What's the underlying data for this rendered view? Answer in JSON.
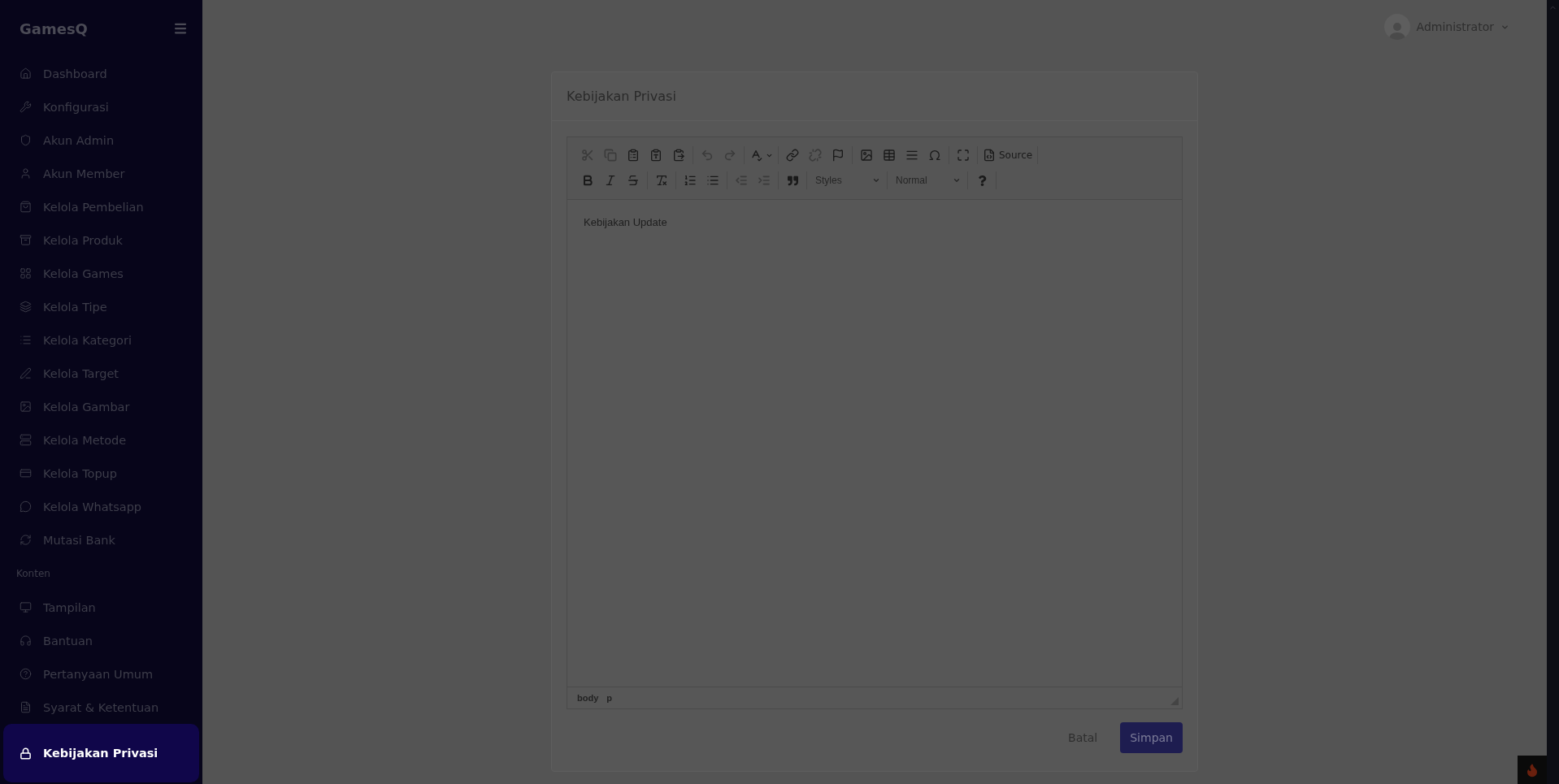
{
  "sidebar": {
    "brand": "GamesQ",
    "sections": [
      {
        "items": [
          {
            "kind": "home",
            "label": "Dashboard",
            "selected": false
          },
          {
            "kind": "wrench",
            "label": "Konfigurasi",
            "selected": false
          },
          {
            "kind": "shield",
            "label": "Akun Admin",
            "selected": false
          },
          {
            "kind": "user",
            "label": "Akun Member",
            "selected": false
          },
          {
            "kind": "bag",
            "label": "Kelola Pembelian",
            "selected": false
          },
          {
            "kind": "archive",
            "label": "Kelola Produk",
            "selected": false
          },
          {
            "kind": "grid",
            "label": "Kelola Games",
            "selected": false
          },
          {
            "kind": "layers",
            "label": "Kelola Tipe",
            "selected": false
          },
          {
            "kind": "list",
            "label": "Kelola Kategori",
            "selected": false
          },
          {
            "kind": "pen",
            "label": "Kelola Target",
            "selected": false
          },
          {
            "kind": "image",
            "label": "Kelola Gambar",
            "selected": false
          },
          {
            "kind": "server",
            "label": "Kelola Metode",
            "selected": false
          },
          {
            "kind": "card",
            "label": "Kelola Topup",
            "selected": false
          },
          {
            "kind": "chat",
            "label": "Kelola Whatsapp",
            "selected": false
          },
          {
            "kind": "refresh",
            "label": "Mutasi Bank",
            "selected": false
          }
        ]
      },
      {
        "heading": "Konten",
        "items": [
          {
            "kind": "monitor",
            "label": "Tampilan",
            "selected": false
          },
          {
            "kind": "headphones",
            "label": "Bantuan",
            "selected": false
          },
          {
            "kind": "help",
            "label": "Pertanyaan Umum",
            "selected": false
          },
          {
            "kind": "file",
            "label": "Syarat & Ketentuan",
            "selected": false
          },
          {
            "kind": "lock",
            "label": "Kebijakan Privasi",
            "selected": true
          }
        ]
      }
    ]
  },
  "user": {
    "name": "Administrator"
  },
  "card": {
    "title": "Kebijakan Privasi"
  },
  "editor": {
    "toolbar": [
      [
        [
          {
            "kind": "cut",
            "disabled": true
          },
          {
            "kind": "copy",
            "disabled": true
          },
          {
            "kind": "paste",
            "disabled": false
          },
          {
            "kind": "paste-text",
            "disabled": false
          },
          {
            "kind": "paste-word",
            "disabled": false
          }
        ],
        [
          {
            "kind": "undo",
            "disabled": true
          },
          {
            "kind": "redo",
            "disabled": true
          }
        ],
        [
          {
            "kind": "spellcheck",
            "disabled": false
          }
        ],
        [
          {
            "kind": "link",
            "disabled": false
          },
          {
            "kind": "unlink",
            "disabled": true
          },
          {
            "kind": "anchor",
            "disabled": false
          }
        ],
        [
          {
            "kind": "image",
            "disabled": false
          },
          {
            "kind": "table",
            "disabled": false
          },
          {
            "kind": "rule",
            "disabled": false
          },
          {
            "kind": "symbol",
            "disabled": false
          }
        ],
        [
          {
            "kind": "maximize",
            "disabled": false
          }
        ],
        [
          {
            "kind": "source",
            "label": "Source",
            "disabled": false
          }
        ]
      ],
      [
        [
          {
            "kind": "bold",
            "disabled": false
          },
          {
            "kind": "italic",
            "disabled": false
          },
          {
            "kind": "strike",
            "disabled": false
          }
        ],
        [
          {
            "kind": "clear",
            "disabled": false
          }
        ],
        [
          {
            "kind": "numbered",
            "disabled": false
          },
          {
            "kind": "bulleted",
            "disabled": false
          }
        ],
        [
          {
            "kind": "outdent",
            "disabled": true
          },
          {
            "kind": "indent",
            "disabled": true
          }
        ],
        [
          {
            "kind": "quote",
            "disabled": false
          }
        ],
        [
          {
            "kind": "combo",
            "label": "Styles",
            "disabled": false
          }
        ],
        [
          {
            "kind": "combo",
            "label": "Normal",
            "disabled": false
          }
        ],
        [
          {
            "kind": "about",
            "disabled": false
          }
        ]
      ]
    ],
    "content": "Kebijakan Update",
    "path": [
      "body",
      "p"
    ]
  },
  "actions": [
    {
      "kind": "link",
      "label": "Batal"
    },
    {
      "kind": "primary",
      "label": "Simpan"
    }
  ]
}
